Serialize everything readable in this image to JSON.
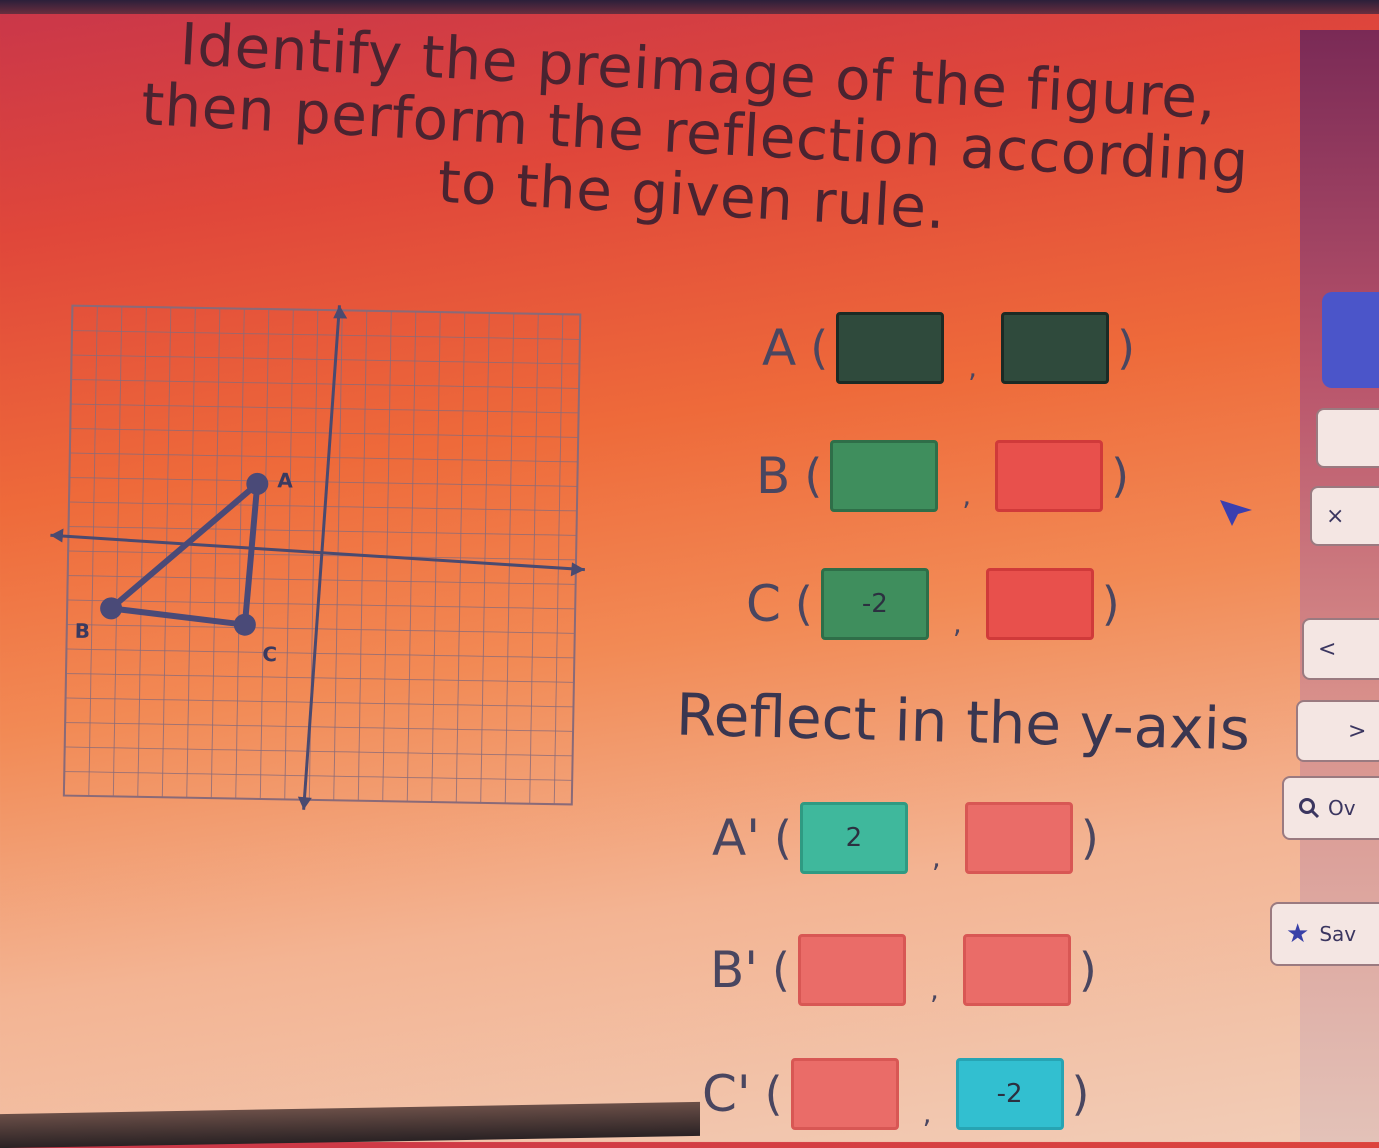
{
  "title": "Identify the preimage of the figure, then perform the reflection according to the given rule.",
  "graph": {
    "point_labels": [
      "A",
      "B",
      "C"
    ]
  },
  "preimage": [
    {
      "label": "A",
      "x": "",
      "y": ""
    },
    {
      "label": "B",
      "x": "",
      "y": ""
    },
    {
      "label": "C",
      "x": "-2",
      "y": ""
    }
  ],
  "rule": "Reflect in the y-axis",
  "image": [
    {
      "label": "A'",
      "x": "2",
      "y": ""
    },
    {
      "label": "B'",
      "x": "",
      "y": ""
    },
    {
      "label": "C'",
      "x": "",
      "y": "-2"
    }
  ],
  "sidebar": {
    "close_label": "×",
    "prev_label": "<",
    "next_label": ">",
    "search_label": "Ov",
    "save_label": "Sav"
  }
}
